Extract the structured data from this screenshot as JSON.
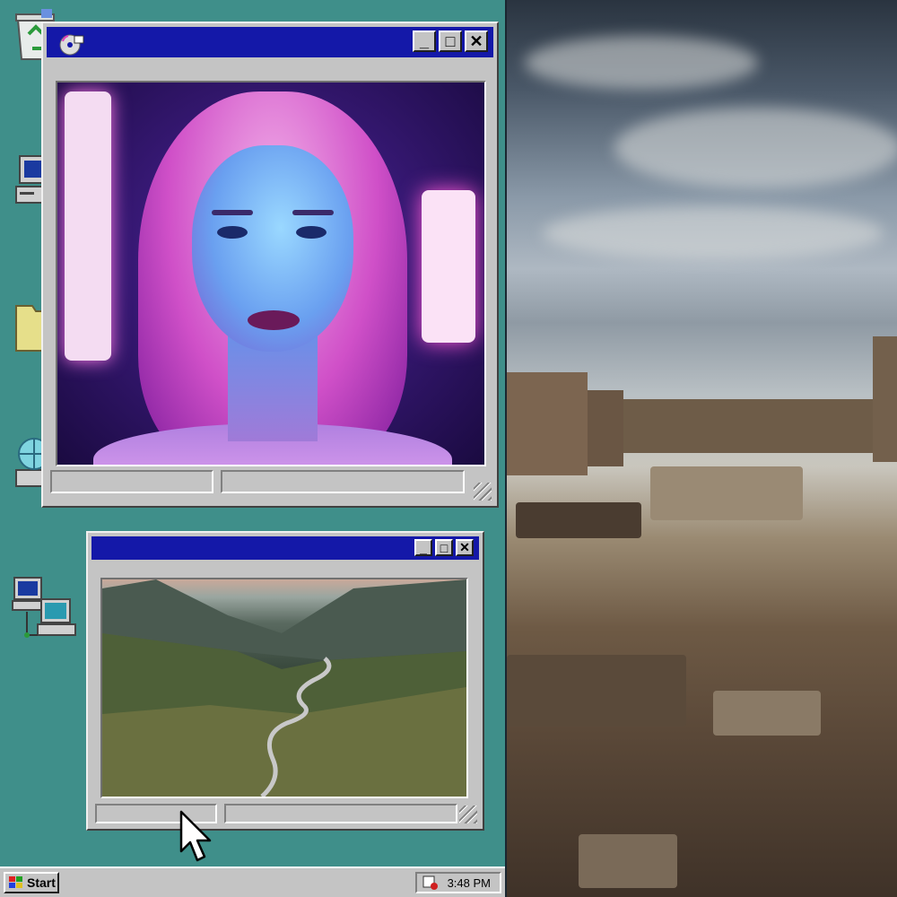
{
  "desktop": {
    "icons": [
      {
        "name": "recycle-bin-icon"
      },
      {
        "name": "my-computer-icon"
      },
      {
        "name": "folder-icon"
      },
      {
        "name": "internet-globe-icon"
      },
      {
        "name": "network-neighborhood-icon"
      }
    ]
  },
  "window_portrait": {
    "title_icon": "cd-player-icon",
    "buttons": {
      "minimize": "_",
      "maximize": "□",
      "close": "✕"
    }
  },
  "window_landscape": {
    "buttons": {
      "minimize": "_",
      "maximize": "□",
      "close": "✕"
    }
  },
  "taskbar": {
    "start_label": "Start",
    "clock": "3:48 PM"
  },
  "colors": {
    "desktop": "#3f8f8a",
    "titlebar": "#1418a8",
    "chrome": "#c4c4c4"
  }
}
